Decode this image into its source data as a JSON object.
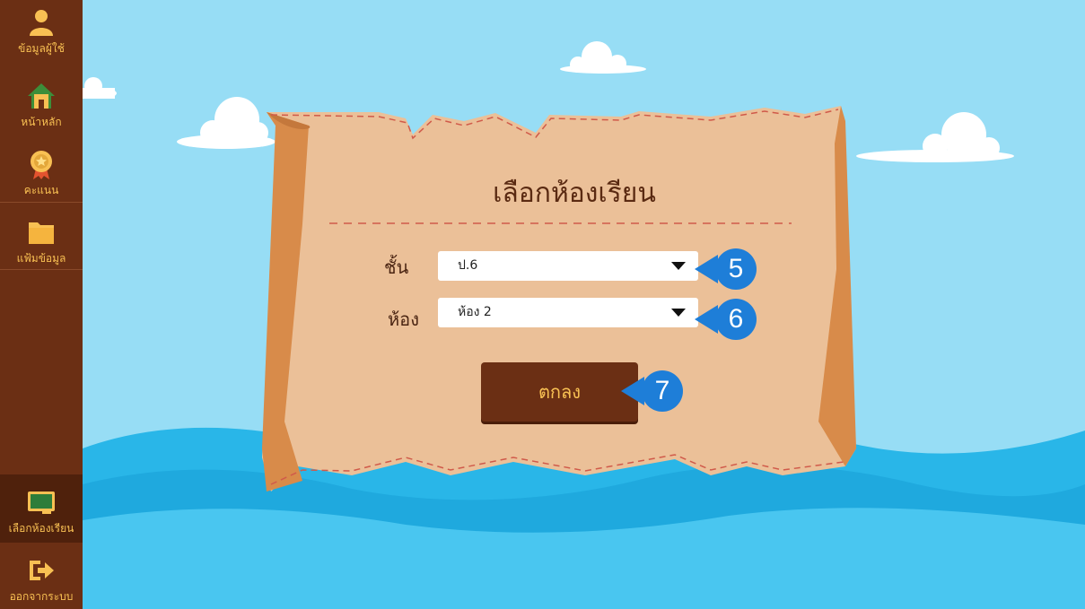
{
  "sidebar": {
    "items": [
      {
        "label": "ข้อมูลผู้ใช้",
        "icon": "user-icon"
      },
      {
        "label": "หน้าหลัก",
        "icon": "home-icon"
      },
      {
        "label": "คะแนน",
        "icon": "medal-icon"
      },
      {
        "label": "แฟ้มข้อมูล",
        "icon": "folder-icon"
      }
    ],
    "bottom_items": [
      {
        "label": "เลือกห้องเรียน",
        "icon": "classroom-board-icon",
        "active": true
      },
      {
        "label": "ออกจากระบบ",
        "icon": "logout-icon"
      }
    ]
  },
  "dialog": {
    "title": "เลือกห้องเรียน",
    "grade_label": "ชั้น",
    "grade_value": "ป.6",
    "room_label": "ห้อง",
    "room_value": "ห้อง 2",
    "ok_label": "ตกลง"
  },
  "callouts": [
    "5",
    "6",
    "7"
  ],
  "colors": {
    "sidebar": "#6B2F14",
    "accent": "#F8C053",
    "sky": "#97DDF5",
    "sea": "#29B6E8",
    "parchment": "#EBC098",
    "callout": "#1E7ED8"
  }
}
